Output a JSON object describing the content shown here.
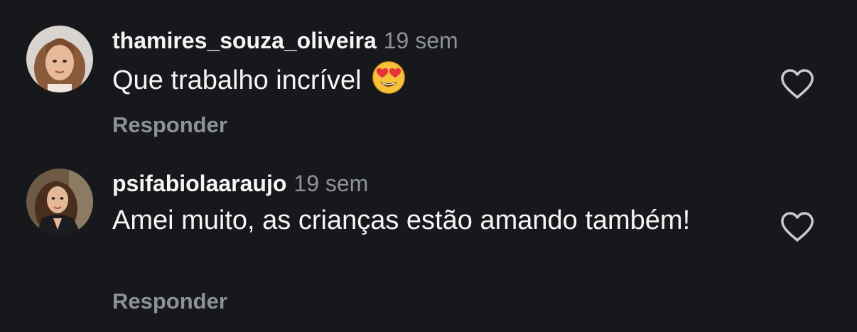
{
  "comments": [
    {
      "username": "thamires_souza_oliveira",
      "time": "19 sem",
      "text": "Que trabalho incrível",
      "emoji": "heart-eyes-emoji",
      "reply_label": "Responder",
      "avatar": "avatar-photo",
      "like_icon": "heart-outline-icon"
    },
    {
      "username": "psifabiolaaraujo",
      "time": "19 sem",
      "text": "Amei muito, as crianças estão amando também!",
      "reply_label": "Responder",
      "avatar": "avatar-photo",
      "like_icon": "heart-outline-icon"
    }
  ],
  "colors": {
    "background": "#16181c",
    "primary_text": "#f5f5f5",
    "secondary_text": "#8e9196",
    "heart_outline": "#c8cacd"
  }
}
